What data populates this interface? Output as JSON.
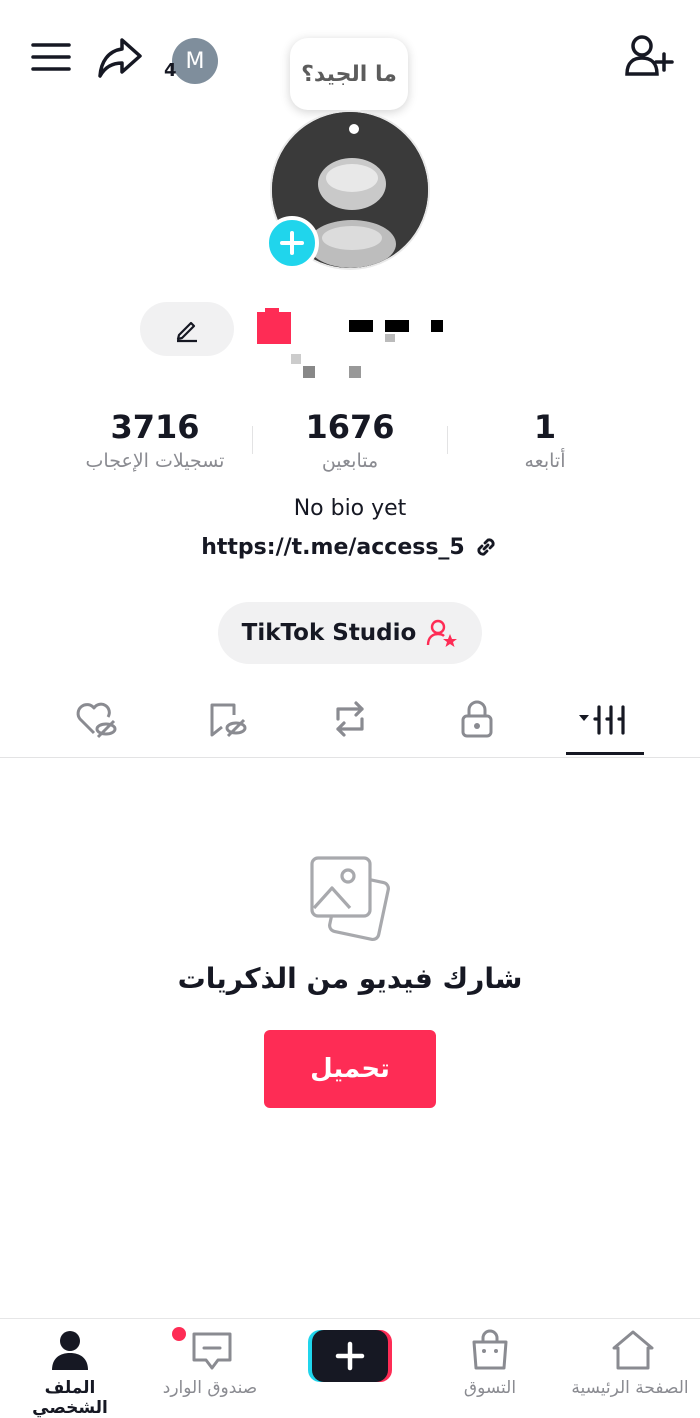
{
  "header": {
    "menu_icon": "hamburger-menu-icon",
    "share_icon": "share-arrow-icon",
    "avatar_initial": "M",
    "avatar_count": "4",
    "add_friend_icon": "person-add-icon"
  },
  "bubble": {
    "text": "ما الجيد؟"
  },
  "profile": {
    "photo_icon": "profile-photo",
    "add_photo_icon": "plus-icon",
    "edit_icon": "pencil-icon"
  },
  "stats": {
    "likes_value": "3716",
    "likes_label": "تسجيلات الإعجاب",
    "followers_value": "1676",
    "followers_label": "متابعين",
    "following_value": "1",
    "following_label": "أتابعه"
  },
  "bio": {
    "text": "No bio yet",
    "link": "https://t.me/access_5",
    "link_icon": "link-icon"
  },
  "studio": {
    "label": "TikTok Studio",
    "icon": "creator-star-icon"
  },
  "tabs": [
    {
      "name": "liked",
      "icon": "heart-hidden-icon"
    },
    {
      "name": "favorites",
      "icon": "bookmark-hidden-icon"
    },
    {
      "name": "reposts",
      "icon": "repost-icon"
    },
    {
      "name": "private",
      "icon": "lock-icon"
    },
    {
      "name": "videos",
      "icon": "grid-icon",
      "active": true
    }
  ],
  "empty_state": {
    "icon": "photos-icon",
    "title": "شارك فيديو من الذكريات",
    "button": "تحميل"
  },
  "bottom_nav": {
    "home": "الصفحة الرئيسية",
    "shop": "التسوق",
    "create_icon": "plus-icon",
    "inbox": "صندوق الوارد",
    "profile": "الملف الشخصي"
  },
  "colors": {
    "accent": "#fe2c55",
    "cyan": "#20d5ec",
    "text": "#161823",
    "muted": "#8a8b91"
  }
}
